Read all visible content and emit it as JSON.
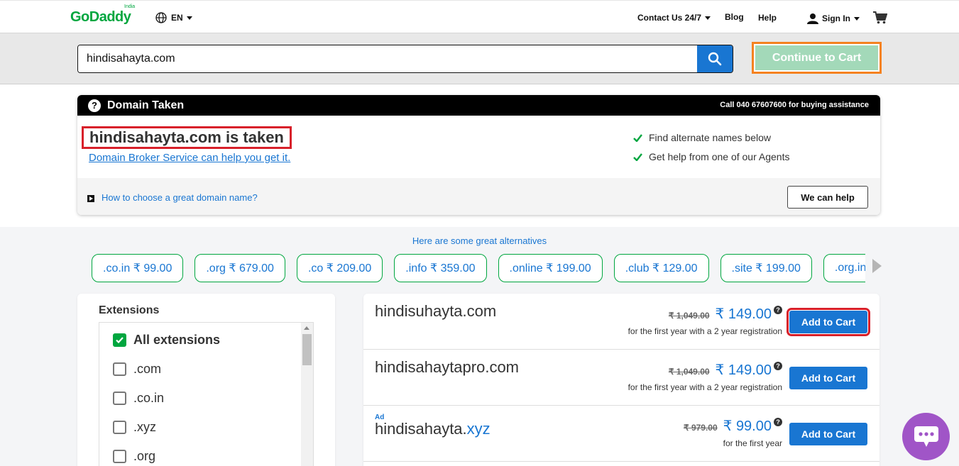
{
  "header": {
    "logo": "GoDaddy",
    "logo_region": "India",
    "language": "EN",
    "contact": "Contact Us 24/7",
    "blog": "Blog",
    "help": "Help",
    "signin": "Sign In"
  },
  "search": {
    "value": "hindisahayta.com",
    "continue_label": "Continue to Cart"
  },
  "taken": {
    "header_title": "Domain Taken",
    "call_text": "Call 040 67607600 for buying assistance",
    "headline": "hindisahayta.com is taken",
    "broker_link": "Domain Broker Service can help you get it.",
    "checks": [
      "Find alternate names below",
      "Get help from one of our Agents"
    ],
    "howto_link": "How to choose a great domain name?",
    "help_button": "We can help"
  },
  "alternatives": {
    "heading": "Here are some great alternatives",
    "chips": [
      ".co.in ₹ 99.00",
      ".org ₹ 679.00",
      ".co ₹ 209.00",
      ".info ₹ 359.00",
      ".online ₹ 199.00",
      ".club ₹ 129.00",
      ".site ₹ 199.00",
      ".org.in"
    ]
  },
  "extensions": {
    "title": "Extensions",
    "items": [
      {
        "label": "All extensions",
        "checked": true
      },
      {
        "label": ".com",
        "checked": false
      },
      {
        "label": ".co.in",
        "checked": false
      },
      {
        "label": ".xyz",
        "checked": false
      },
      {
        "label": ".org",
        "checked": false
      }
    ]
  },
  "results": [
    {
      "sld": "hindisuhayta.com",
      "tld": "",
      "ad": "",
      "old_price": "₹ 1,049.00",
      "price": "₹ 149.00",
      "term": "for the first year with a 2 year registration",
      "button": "Add to Cart",
      "highlighted": true
    },
    {
      "sld": "hindisahaytapro.com",
      "tld": "",
      "ad": "",
      "old_price": "₹ 1,049.00",
      "price": "₹ 149.00",
      "term": "for the first year with a 2 year registration",
      "button": "Add to Cart",
      "highlighted": false
    },
    {
      "sld": "hindisahayta.",
      "tld": "xyz",
      "ad": "Ad",
      "old_price": "₹ 979.00",
      "price": "₹ 99.00",
      "term": "for the first year",
      "button": "Add to Cart",
      "highlighted": false
    }
  ],
  "colors": {
    "brand_green": "#00a63f",
    "primary_blue": "#1976d2",
    "highlight_red": "#d8202a",
    "highlight_orange": "#f58220",
    "chat_purple": "#a055c7"
  }
}
